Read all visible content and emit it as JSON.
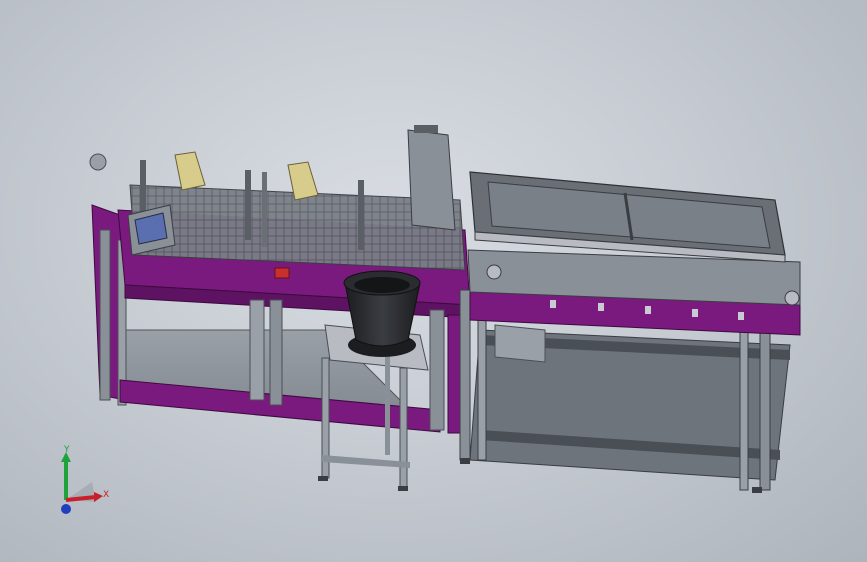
{
  "triad": {
    "x_label": "X",
    "y_label": "Y",
    "colors": {
      "x": "#c8202a",
      "y": "#1ea23a",
      "z": "#1f3fbf"
    }
  },
  "colors": {
    "background": "#c7ccd3",
    "frame_purple": "#7a1a7e",
    "frame_grey": "#8a9098",
    "frame_dark": "#4a4f55",
    "bowl": "#2a2c30",
    "accent_yellow": "#d8cc8c",
    "accent_red": "#c83030",
    "hmi_screen": "#5a6fb0"
  }
}
